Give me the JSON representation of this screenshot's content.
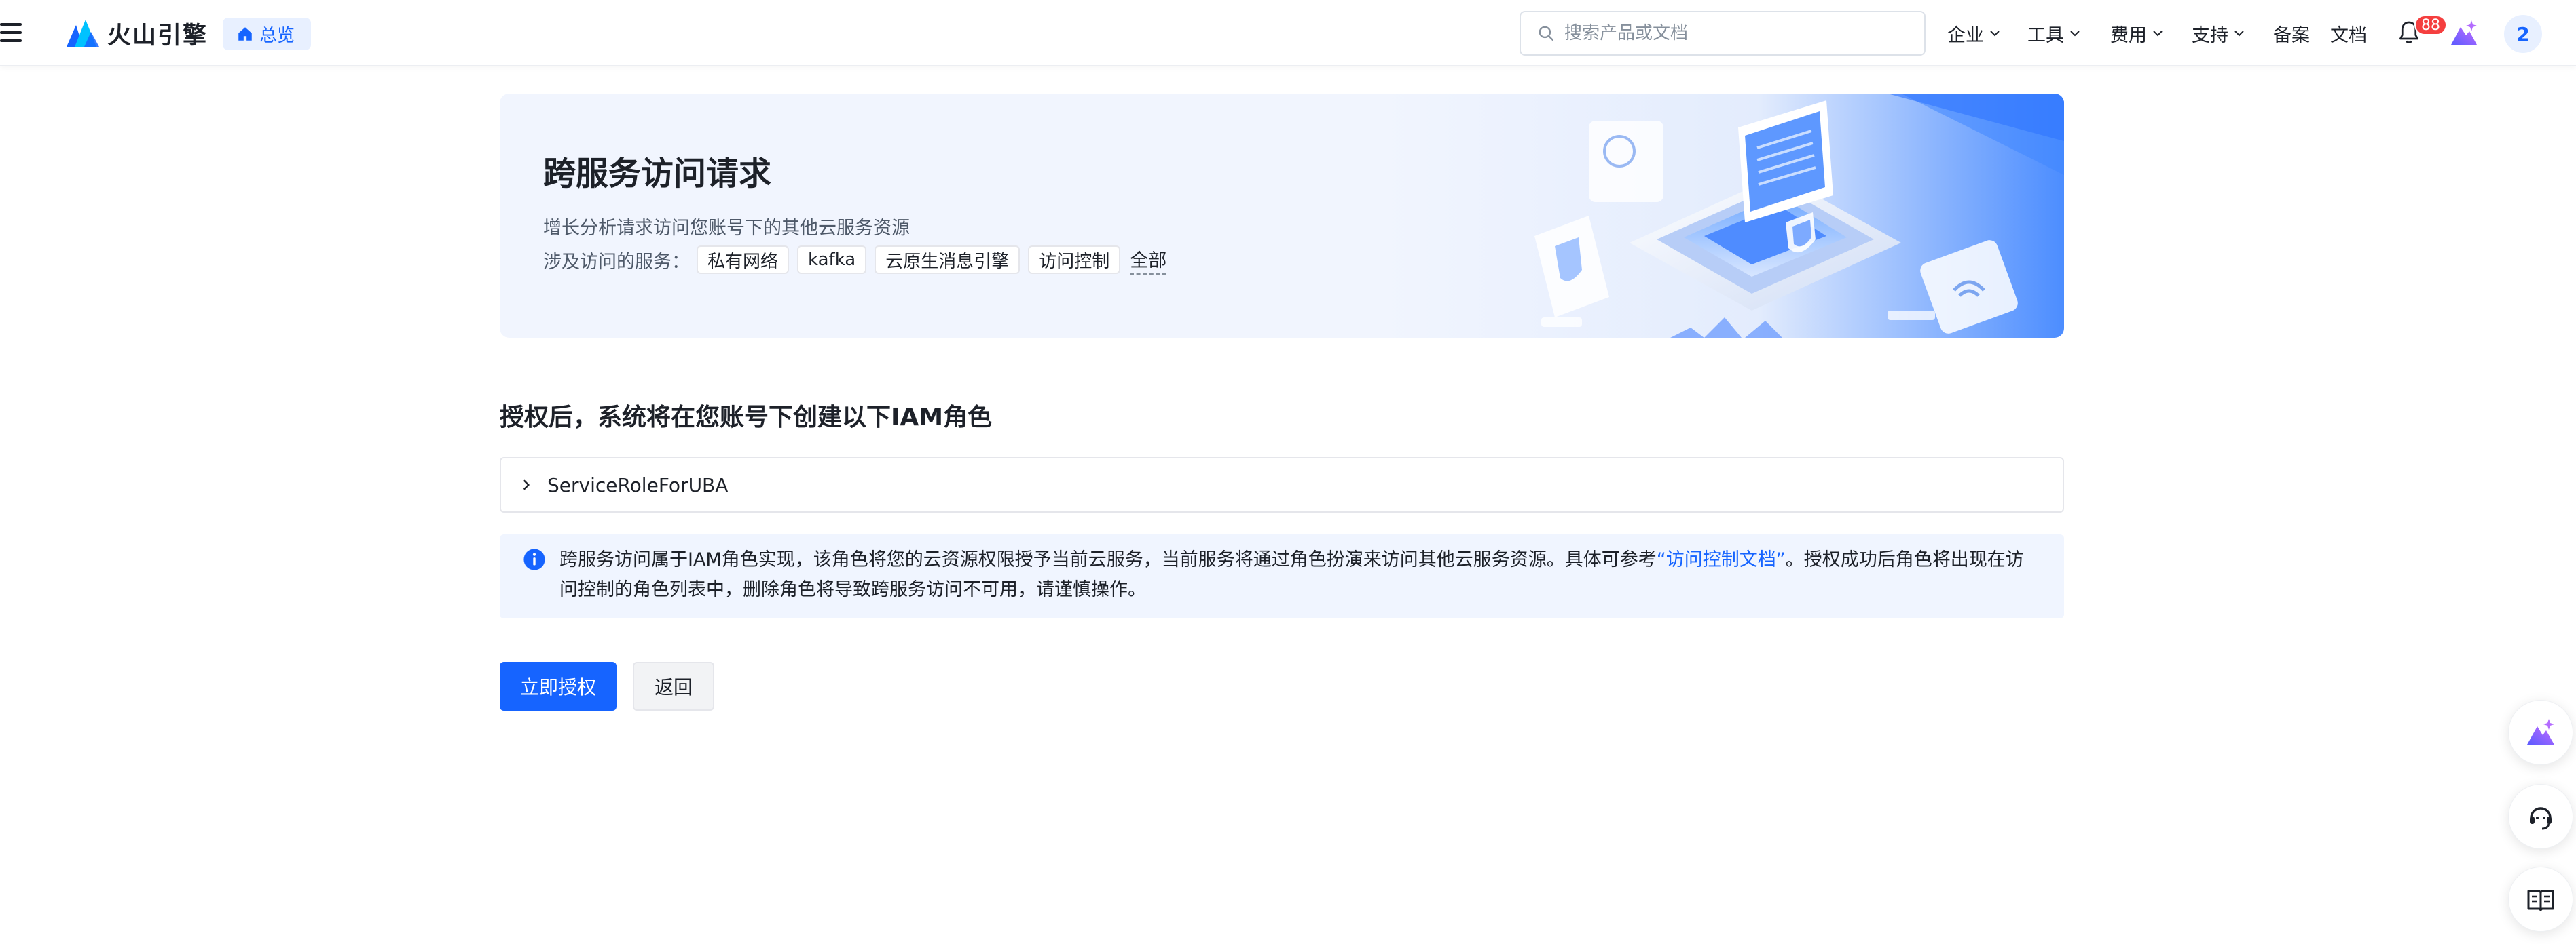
{
  "header": {
    "logo_text": "火山引擎",
    "overview_label": "总览",
    "search_placeholder": "搜索产品或文档",
    "nav": [
      {
        "label": "企业",
        "dropdown": true
      },
      {
        "label": "工具",
        "dropdown": true
      },
      {
        "label": "费用",
        "dropdown": true
      },
      {
        "label": "支持",
        "dropdown": true
      },
      {
        "label": "备案",
        "dropdown": false
      },
      {
        "label": "文档",
        "dropdown": false
      }
    ],
    "notification_count": "88",
    "avatar_text": "2"
  },
  "banner": {
    "title": "跨服务访问请求",
    "description": "增长分析请求访问您账号下的其他云服务资源",
    "services_label": "涉及访问的服务：",
    "services": [
      "私有网络",
      "kafka",
      "云原生消息引擎",
      "访问控制"
    ],
    "services_all": "全部"
  },
  "section": {
    "title": "授权后，系统将在您账号下创建以下IAM角色",
    "role_name": "ServiceRoleForUBA",
    "notice_before": "跨服务访问属于IAM角色实现，该角色将您的云资源权限授予当前云服务，当前服务将通过角色扮演来访问其他云服务资源。具体可参考",
    "notice_link": "“访问控制文档”",
    "notice_after": "。授权成功后角色将出现在访问控制的角色列表中，删除角色将导致跨服务访问不可用，请谨慎操作。"
  },
  "actions": {
    "authorize_label": "立即授权",
    "back_label": "返回"
  },
  "colors": {
    "primary": "#1664ff",
    "badge": "#f53f3f",
    "banner_bg": "#f1f5fe",
    "notice_bg": "#f0f5ff"
  },
  "icons": {
    "menu": "hamburger-menu-icon",
    "logo": "volcano-logo-icon",
    "home": "home-icon",
    "search": "search-icon",
    "chevron": "chevron-down-icon",
    "bell": "bell-icon",
    "ai": "ai-assistant-icon",
    "expand": "chevron-right-icon",
    "info": "info-icon",
    "headset": "customer-service-icon",
    "book": "book-icon"
  }
}
